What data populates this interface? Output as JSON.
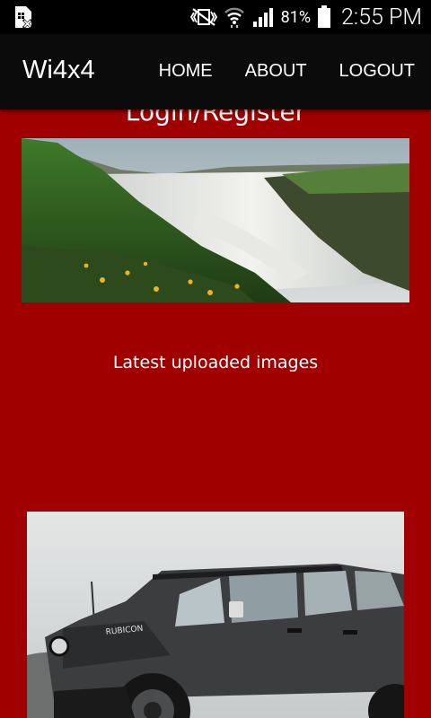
{
  "status_bar": {
    "battery_percent": "81%",
    "time": "2:55 PM",
    "icons": [
      "sim-card-x-icon",
      "mute-vibrate-icon",
      "wifi-icon",
      "cell-signal-icon",
      "battery-icon"
    ]
  },
  "navbar": {
    "brand": "Wi4x4",
    "links": [
      "HOME",
      "ABOUT",
      "LOGOUT"
    ]
  },
  "page": {
    "login_title": "Login/Register",
    "latest_heading": "Latest uploaded images"
  },
  "colors": {
    "page_background": "#a00000",
    "navbar": "#0b0b0b",
    "status_bar": "#000000"
  }
}
